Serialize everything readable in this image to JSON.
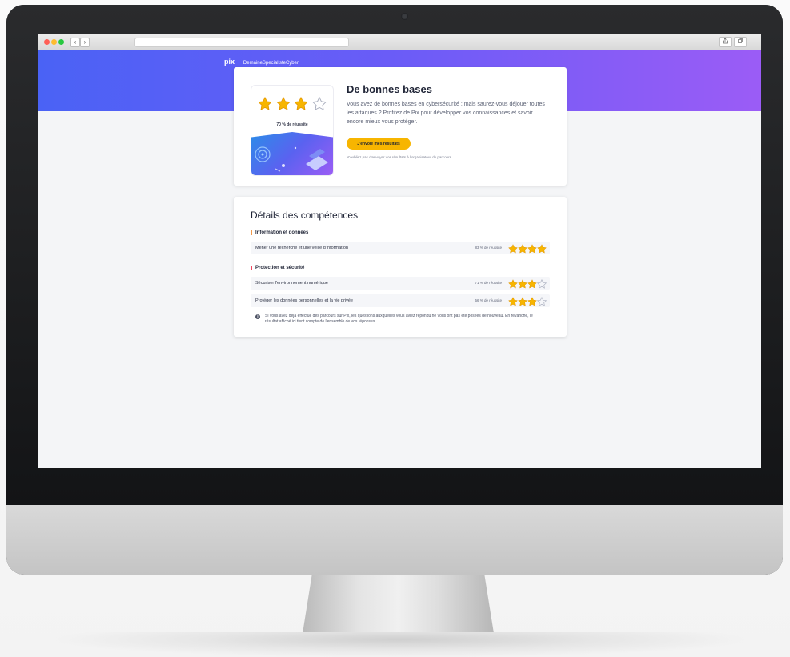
{
  "browser": {
    "back_label": "‹",
    "forward_label": "›",
    "share_icon": "share-icon",
    "tabs_icon": "tabs-icon"
  },
  "header": {
    "logo": "pix",
    "separator": "|",
    "campaign": "DemaineSpecialisteCyber"
  },
  "result": {
    "stars_filled": 3,
    "stars_total": 4,
    "rate_text": "70 % de réussite",
    "title": "De bonnes bases",
    "description": "Vous avez de bonnes bases en cybersécurité : mais saurez-vous déjouer toutes les attaques ? Profitez de Pix pour développer vos connaissances et savoir encore mieux vous protéger.",
    "send_button": "J'envoie mes résultats",
    "reminder": "N'oubliez pas d'envoyer vos résultats à l'organisateur du parcours."
  },
  "details": {
    "title": "Détails des compétences",
    "sections": [
      {
        "title": "Information et données",
        "color": "#f2994a",
        "competences": [
          {
            "label": "Mener une recherche et une veille d'information",
            "rate": "83 % de réussite",
            "stars": 4
          }
        ]
      },
      {
        "title": "Protection et sécurité",
        "color": "#f0465e",
        "competences": [
          {
            "label": "Sécuriser l'environnement numérique",
            "rate": "71 % de réussite",
            "stars": 3
          },
          {
            "label": "Protéger les données personnelles et la vie privée",
            "rate": "56 % de réussite",
            "stars": 3
          }
        ]
      }
    ],
    "info_text": "Si vous avez déjà effectué des parcours sur Pix, les questions auxquelles vous aviez répondu ne vous ont pas été posées de nouveau. En revanche, le résultat affiché ici tient compte de l'ensemble de vos réponses."
  },
  "colors": {
    "star_filled": "#f7b500",
    "star_empty": "#a8adbd",
    "accent_button": "#f7b500"
  }
}
